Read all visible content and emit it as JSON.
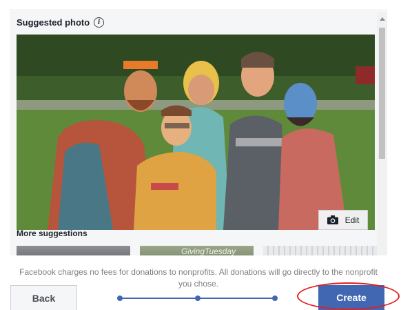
{
  "suggested": {
    "title": "Suggested photo",
    "info_glyph": "i",
    "edit_label": "Edit"
  },
  "more": {
    "title": "More suggestions",
    "thumb2_text": "GivingTuesday"
  },
  "footer": {
    "notice": "Facebook charges no fees for donations to nonprofits. All donations will go directly to the nonprofit you chose.",
    "back_label": "Back",
    "create_label": "Create",
    "steps_total": 3,
    "current_step": 3
  },
  "colors": {
    "primary": "#4267b2",
    "annotation": "#e02020",
    "panel_bg": "#f5f6f7"
  },
  "icons": {
    "info": "info-icon",
    "camera": "camera-icon"
  }
}
